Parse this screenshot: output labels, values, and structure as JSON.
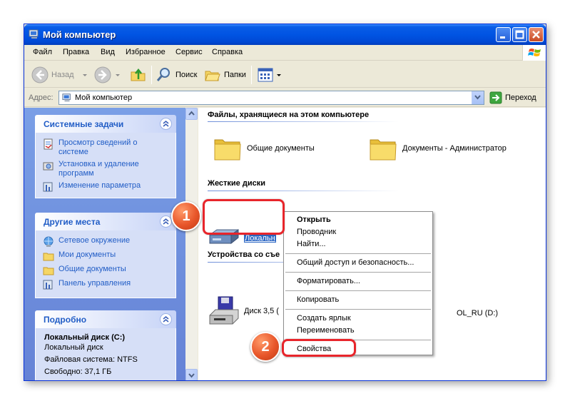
{
  "window": {
    "title": "Мой компьютер"
  },
  "menu": [
    "Файл",
    "Правка",
    "Вид",
    "Избранное",
    "Сервис",
    "Справка"
  ],
  "toolbar": {
    "back": "Назад",
    "search": "Поиск",
    "folders": "Папки"
  },
  "address": {
    "label": "Адрес:",
    "value": "Мой компьютер",
    "go": "Переход"
  },
  "left_panels": {
    "system_tasks": {
      "title": "Системные задачи",
      "items": [
        "Просмотр сведений о системе",
        "Установка и удаление программ",
        "Изменение параметра"
      ]
    },
    "other_places": {
      "title": "Другие места",
      "items": [
        "Сетевое окружение",
        "Мои документы",
        "Общие документы",
        "Панель управления"
      ]
    },
    "details": {
      "title": "Подробно",
      "name": "Локальный диск (C:)",
      "type": "Локальный диск",
      "fs": "Файловая система: NTFS",
      "free": "Свободно: 37,1 ГБ"
    }
  },
  "groups": {
    "files": {
      "title": "Файлы, хранящиеся на этом компьютере",
      "items": [
        "Общие документы",
        "Документы - Администратор"
      ]
    },
    "hdd": {
      "title": "Жесткие диски",
      "items": [
        "Локальн"
      ]
    },
    "removable": {
      "title": "Устройства со съе",
      "items": [
        "Диск 3,5 (",
        "OL_RU (D:)"
      ]
    }
  },
  "context_menu": [
    "Открыть",
    "Проводник",
    "Найти...",
    "Общий доступ и безопасность...",
    "Форматировать...",
    "Копировать",
    "Создать ярлык",
    "Переименовать",
    "Свойства"
  ],
  "callouts": [
    "1",
    "2"
  ],
  "colors": {
    "title_bar": "#0054e3",
    "task_link": "#215dc6",
    "highlight": "#e8252b",
    "badge": "#e8562a"
  }
}
